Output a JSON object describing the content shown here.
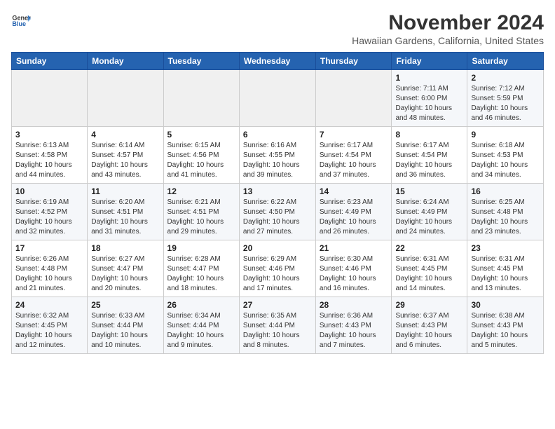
{
  "header": {
    "logo_line1": "General",
    "logo_line2": "Blue",
    "title": "November 2024",
    "subtitle": "Hawaiian Gardens, California, United States"
  },
  "weekdays": [
    "Sunday",
    "Monday",
    "Tuesday",
    "Wednesday",
    "Thursday",
    "Friday",
    "Saturday"
  ],
  "weeks": [
    [
      {
        "day": "",
        "info": ""
      },
      {
        "day": "",
        "info": ""
      },
      {
        "day": "",
        "info": ""
      },
      {
        "day": "",
        "info": ""
      },
      {
        "day": "",
        "info": ""
      },
      {
        "day": "1",
        "info": "Sunrise: 7:11 AM\nSunset: 6:00 PM\nDaylight: 10 hours and 48 minutes."
      },
      {
        "day": "2",
        "info": "Sunrise: 7:12 AM\nSunset: 5:59 PM\nDaylight: 10 hours and 46 minutes."
      }
    ],
    [
      {
        "day": "3",
        "info": "Sunrise: 6:13 AM\nSunset: 4:58 PM\nDaylight: 10 hours and 44 minutes."
      },
      {
        "day": "4",
        "info": "Sunrise: 6:14 AM\nSunset: 4:57 PM\nDaylight: 10 hours and 43 minutes."
      },
      {
        "day": "5",
        "info": "Sunrise: 6:15 AM\nSunset: 4:56 PM\nDaylight: 10 hours and 41 minutes."
      },
      {
        "day": "6",
        "info": "Sunrise: 6:16 AM\nSunset: 4:55 PM\nDaylight: 10 hours and 39 minutes."
      },
      {
        "day": "7",
        "info": "Sunrise: 6:17 AM\nSunset: 4:54 PM\nDaylight: 10 hours and 37 minutes."
      },
      {
        "day": "8",
        "info": "Sunrise: 6:17 AM\nSunset: 4:54 PM\nDaylight: 10 hours and 36 minutes."
      },
      {
        "day": "9",
        "info": "Sunrise: 6:18 AM\nSunset: 4:53 PM\nDaylight: 10 hours and 34 minutes."
      }
    ],
    [
      {
        "day": "10",
        "info": "Sunrise: 6:19 AM\nSunset: 4:52 PM\nDaylight: 10 hours and 32 minutes."
      },
      {
        "day": "11",
        "info": "Sunrise: 6:20 AM\nSunset: 4:51 PM\nDaylight: 10 hours and 31 minutes."
      },
      {
        "day": "12",
        "info": "Sunrise: 6:21 AM\nSunset: 4:51 PM\nDaylight: 10 hours and 29 minutes."
      },
      {
        "day": "13",
        "info": "Sunrise: 6:22 AM\nSunset: 4:50 PM\nDaylight: 10 hours and 27 minutes."
      },
      {
        "day": "14",
        "info": "Sunrise: 6:23 AM\nSunset: 4:49 PM\nDaylight: 10 hours and 26 minutes."
      },
      {
        "day": "15",
        "info": "Sunrise: 6:24 AM\nSunset: 4:49 PM\nDaylight: 10 hours and 24 minutes."
      },
      {
        "day": "16",
        "info": "Sunrise: 6:25 AM\nSunset: 4:48 PM\nDaylight: 10 hours and 23 minutes."
      }
    ],
    [
      {
        "day": "17",
        "info": "Sunrise: 6:26 AM\nSunset: 4:48 PM\nDaylight: 10 hours and 21 minutes."
      },
      {
        "day": "18",
        "info": "Sunrise: 6:27 AM\nSunset: 4:47 PM\nDaylight: 10 hours and 20 minutes."
      },
      {
        "day": "19",
        "info": "Sunrise: 6:28 AM\nSunset: 4:47 PM\nDaylight: 10 hours and 18 minutes."
      },
      {
        "day": "20",
        "info": "Sunrise: 6:29 AM\nSunset: 4:46 PM\nDaylight: 10 hours and 17 minutes."
      },
      {
        "day": "21",
        "info": "Sunrise: 6:30 AM\nSunset: 4:46 PM\nDaylight: 10 hours and 16 minutes."
      },
      {
        "day": "22",
        "info": "Sunrise: 6:31 AM\nSunset: 4:45 PM\nDaylight: 10 hours and 14 minutes."
      },
      {
        "day": "23",
        "info": "Sunrise: 6:31 AM\nSunset: 4:45 PM\nDaylight: 10 hours and 13 minutes."
      }
    ],
    [
      {
        "day": "24",
        "info": "Sunrise: 6:32 AM\nSunset: 4:45 PM\nDaylight: 10 hours and 12 minutes."
      },
      {
        "day": "25",
        "info": "Sunrise: 6:33 AM\nSunset: 4:44 PM\nDaylight: 10 hours and 10 minutes."
      },
      {
        "day": "26",
        "info": "Sunrise: 6:34 AM\nSunset: 4:44 PM\nDaylight: 10 hours and 9 minutes."
      },
      {
        "day": "27",
        "info": "Sunrise: 6:35 AM\nSunset: 4:44 PM\nDaylight: 10 hours and 8 minutes."
      },
      {
        "day": "28",
        "info": "Sunrise: 6:36 AM\nSunset: 4:43 PM\nDaylight: 10 hours and 7 minutes."
      },
      {
        "day": "29",
        "info": "Sunrise: 6:37 AM\nSunset: 4:43 PM\nDaylight: 10 hours and 6 minutes."
      },
      {
        "day": "30",
        "info": "Sunrise: 6:38 AM\nSunset: 4:43 PM\nDaylight: 10 hours and 5 minutes."
      }
    ]
  ]
}
